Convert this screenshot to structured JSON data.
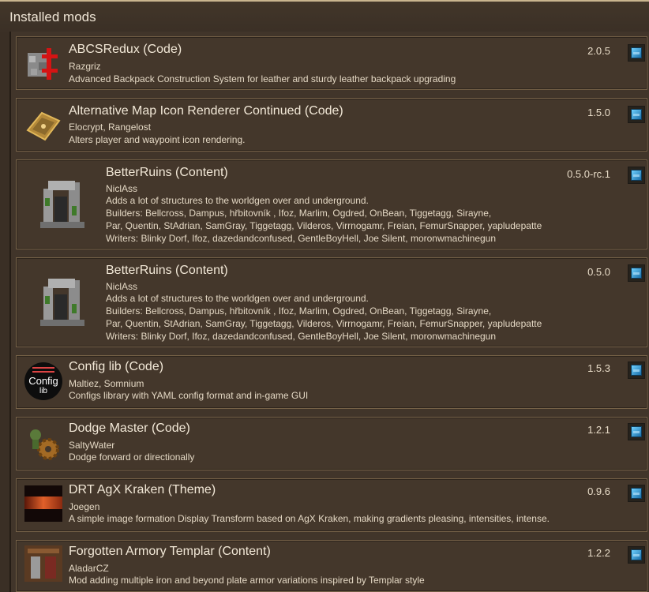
{
  "header": {
    "title": "Installed mods"
  },
  "mods": [
    {
      "name": "ABCSRedux (Code)",
      "version": "2.0.5",
      "authors": "Razgriz",
      "description": "Advanced Backpack Construction System for leather and sturdy leather backpack upgrading",
      "icon": "backpack-icon"
    },
    {
      "name": "Alternative Map Icon Renderer Continued (Code)",
      "version": "1.5.0",
      "authors": "Elocrypt, Rangelost",
      "description": "Alters player and waypoint icon rendering.",
      "icon": "map-icon"
    },
    {
      "name": "BetterRuins (Content)",
      "version": "0.5.0-rc.1",
      "authors": "NiclAss",
      "description": "Adds a lot of structures to the worldgen over and underground.",
      "builders": "Builders: Bellcross, Dampus, hřbitovník , Ifoz, Marlim, Ogdred, OnBean, Tiggetagg, Sirayne,",
      "builders2": "Par, Quentin, StAdrian, SamGray, Tiggetagg, Vilderos, Virrnogamr, Freian, FemurSnapper, yapludepatte",
      "writers": "Writers: Blinky Dorf, Ifoz, dazedandconfused, GentleBoyHell, Joe Silent, moronwmachinegun",
      "icon": "ruins-icon"
    },
    {
      "name": "BetterRuins (Content)",
      "version": "0.5.0",
      "authors": "NiclAss",
      "description": "Adds a lot of structures to the worldgen over and underground.",
      "builders": "Builders: Bellcross, Dampus, hřbitovník , Ifoz, Marlim, Ogdred, OnBean, Tiggetagg, Sirayne,",
      "builders2": "Par, Quentin, StAdrian, SamGray, Tiggetagg, Vilderos, Virrnogamr, Freian, FemurSnapper, yapludepatte",
      "writers": "Writers: Blinky Dorf, Ifoz, dazedandconfused, GentleBoyHell, Joe Silent, moronwmachinegun",
      "icon": "ruins-icon"
    },
    {
      "name": "Config lib (Code)",
      "version": "1.5.3",
      "authors": "Maltiez, Somnium",
      "description": "Configs library with YAML config format and in-game GUI",
      "icon": "config-lib-icon",
      "icon_text": "Config",
      "icon_subtext": "lib"
    },
    {
      "name": "Dodge Master (Code)",
      "version": "1.2.1",
      "authors": "SaltyWater",
      "description": "Dodge forward or directionally",
      "icon": "gear-icon"
    },
    {
      "name": " DRT AgX Kraken (Theme)",
      "version": "0.9.6",
      "authors": "Joegen",
      "description": "A simple image formation Display Transform based on AgX Kraken, making gradients pleasing, intensities, intense.",
      "icon": "glow-icon"
    },
    {
      "name": "Forgotten Armory Templar (Content)",
      "version": "1.2.2",
      "authors": "AladarCZ",
      "description": "Mod adding multiple iron and beyond plate armor variations inspired by Templar style",
      "icon": "armory-icon"
    }
  ],
  "colors": {
    "accent_button": "#3ea6e0",
    "card_border": "#766248",
    "background": "#3a2f25"
  }
}
